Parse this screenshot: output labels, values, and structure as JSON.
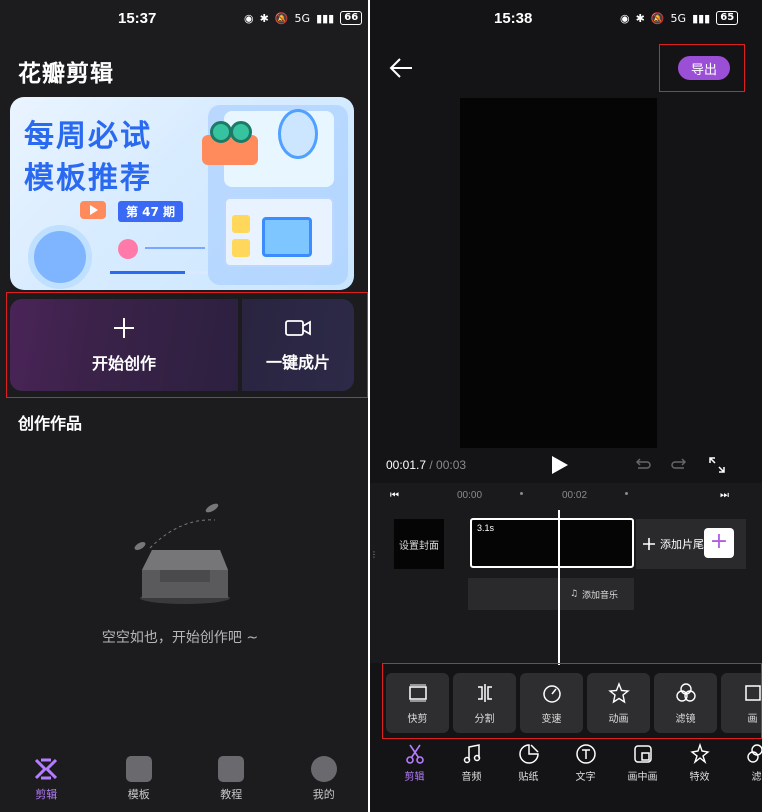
{
  "left": {
    "status": {
      "time": "15:37",
      "signal": "5G",
      "battery": "66"
    },
    "app_title": "花瓣剪辑",
    "banner": {
      "line1": "每周必试",
      "line2": "模板推荐",
      "issue": "第 47 期"
    },
    "actions": {
      "create_label": "开始创作",
      "quick_label": "一键成片"
    },
    "section_title": "创作作品",
    "empty_text": "空空如也，开始创作吧 ~",
    "nav": [
      {
        "label": "剪辑",
        "active": true
      },
      {
        "label": "模板",
        "active": false
      },
      {
        "label": "教程",
        "active": false
      },
      {
        "label": "我的",
        "active": false
      }
    ]
  },
  "right": {
    "status": {
      "time": "15:38",
      "signal": "5G",
      "battery": "65"
    },
    "export_label": "导出",
    "time_current": "00:01.7",
    "time_total": " / 00:03",
    "ruler": {
      "t1": "00:00",
      "t2": "00:02"
    },
    "cover_label": "设置封面",
    "clip_duration": "3.1s",
    "add_tail_label": "添加片尾",
    "add_music_label": "添加音乐",
    "tools": [
      "快剪",
      "分割",
      "变速",
      "动画",
      "滤镜",
      "画"
    ],
    "nav": [
      {
        "label": "剪辑",
        "active": true
      },
      {
        "label": "音频",
        "active": false
      },
      {
        "label": "贴纸",
        "active": false
      },
      {
        "label": "文字",
        "active": false
      },
      {
        "label": "画中画",
        "active": false
      },
      {
        "label": "特效",
        "active": false
      },
      {
        "label": "滤",
        "active": false
      }
    ]
  },
  "colors": {
    "accent": "#9b4fd6",
    "highlight_box": "#e02020",
    "nav_active": "#b67cff"
  }
}
